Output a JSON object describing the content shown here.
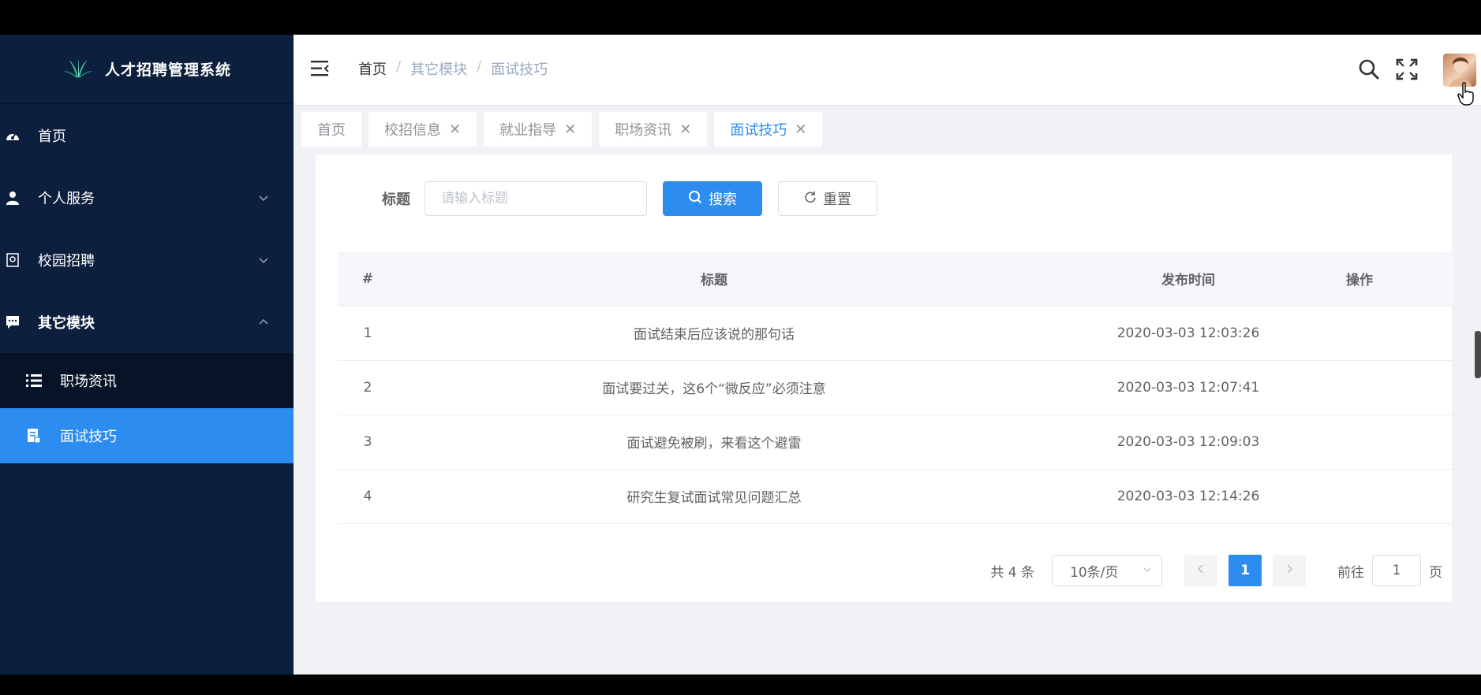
{
  "app": {
    "title": "人才招聘管理系统"
  },
  "sidebar": {
    "items": [
      {
        "label": "首页",
        "icon": "dashboard-icon"
      },
      {
        "label": "个人服务",
        "icon": "user-icon"
      },
      {
        "label": "校园招聘",
        "icon": "campus-icon"
      },
      {
        "label": "其它模块",
        "icon": "message-icon"
      }
    ],
    "sub_items": [
      {
        "label": "职场资讯",
        "icon": "list-icon"
      },
      {
        "label": "面试技巧",
        "icon": "document-icon"
      }
    ]
  },
  "breadcrumb": {
    "home": "首页",
    "sep1": "/",
    "parent": "其它模块",
    "sep2": "/",
    "current": "面试技巧"
  },
  "tags": [
    {
      "label": "首页"
    },
    {
      "label": "校招信息"
    },
    {
      "label": "就业指导"
    },
    {
      "label": "职场资讯"
    },
    {
      "label": "面试技巧"
    }
  ],
  "tag_close": "✕",
  "search": {
    "label": "标题",
    "placeholder": "请输入标题",
    "search_button": "搜索",
    "reset_button": "重置"
  },
  "table": {
    "headers": {
      "index": "#",
      "title": "标题",
      "date": "发布时间",
      "actions": "操作"
    },
    "rows": [
      {
        "index": "1",
        "title": "面试结束后应该说的那句话",
        "date": "2020-03-03 12:03:26"
      },
      {
        "index": "2",
        "title": "面试要过关，这6个“微反应”必须注意",
        "date": "2020-03-03 12:07:41"
      },
      {
        "index": "3",
        "title": "面试避免被刷，来看这个避雷",
        "date": "2020-03-03 12:09:03"
      },
      {
        "index": "4",
        "title": "研究生复试面试常见问题汇总",
        "date": "2020-03-03 12:14:26"
      }
    ]
  },
  "pagination": {
    "total": "共 4 条",
    "page_size": "10条/页",
    "current_page": "1",
    "goto_label": "前往",
    "goto_value": "1",
    "page_suffix": "页"
  },
  "colors": {
    "sidebar_bg": "#0c1f3d",
    "accent": "#2d8cf0"
  }
}
